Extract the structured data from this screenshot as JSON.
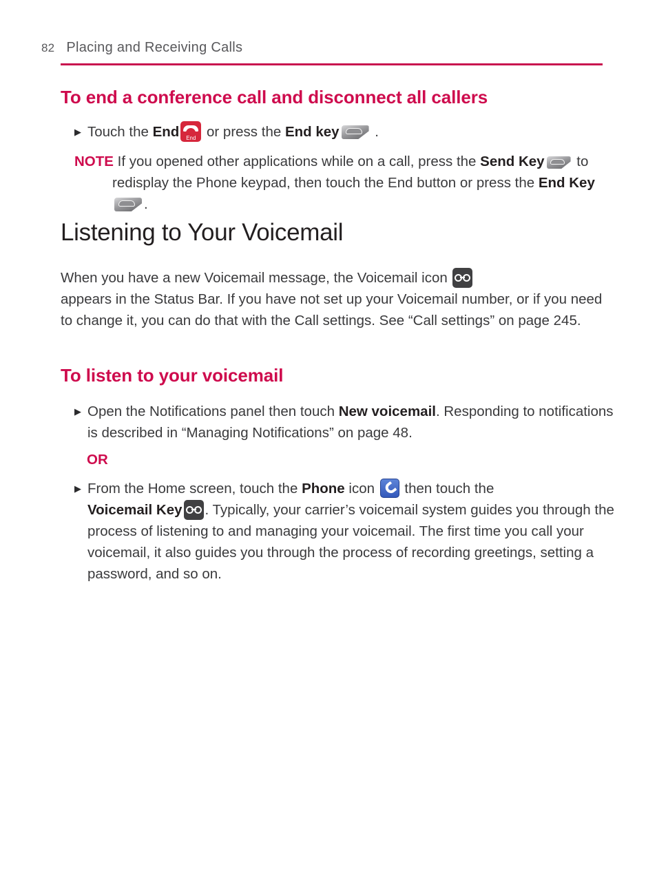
{
  "page": {
    "folio": "82",
    "running_title": "Placing and Receiving Calls",
    "rule_color": "#c8104e",
    "accent_color": "#ce0b4d",
    "text_color": "#3a3a3c"
  },
  "sections": {
    "end_conference": {
      "heading": "To end a conference call and disconnect all callers",
      "bullet": {
        "part1": "Touch the ",
        "bold1": "End",
        "icon1": "end-call-button-icon",
        "part2": " or press the ",
        "bold2": "End key",
        "icon2": "end-hardware-key-icon",
        "part3": " ."
      },
      "note": {
        "label": "NOTE",
        "line1": " If you opened other applications while on a call, press the ",
        "bold1": "Send Key",
        "icon1": "send-hardware-key-icon",
        "line2": " to",
        "line3": "redisplay the Phone keypad, then touch the End button or press the ",
        "bold2": "End Key",
        "icon2": "end-hardware-key-icon",
        "line4": "."
      }
    },
    "voicemail": {
      "heading": "Listening to Your Voicemail",
      "intro": {
        "part1": "When you have a new Voicemail message, the Voicemail icon ",
        "icon": "voicemail-tape-icon",
        "part2": "appears in the Status Bar. If you have not set up your Voicemail number, or if you need to change it, you can do that with the Call settings. See “Call settings” on page 245."
      },
      "subheading": "To listen to your voicemail",
      "bullet1": {
        "part1": "Open the Notifications panel then touch ",
        "bold1": "New voicemail",
        "part2": ". Responding to notifications is described in “Managing Notifications” on page 48."
      },
      "or_label": "OR",
      "bullet2": {
        "part1": "From the Home screen, touch the ",
        "bold1": "Phone",
        "part2": " icon ",
        "icon1": "phone-app-icon",
        "part3": " then touch the ",
        "bold2": "Voicemail Key",
        "icon2": "voicemail-tape-icon",
        "part4": ". Typically, your carrier’s voicemail system guides you through the process of listening to and managing your voicemail. The first time you call your voicemail, it also guides you through the process of recording greetings, setting a password, and so on."
      }
    }
  },
  "icons": {
    "end_button_label": "End",
    "bullet_marker": "▶"
  }
}
